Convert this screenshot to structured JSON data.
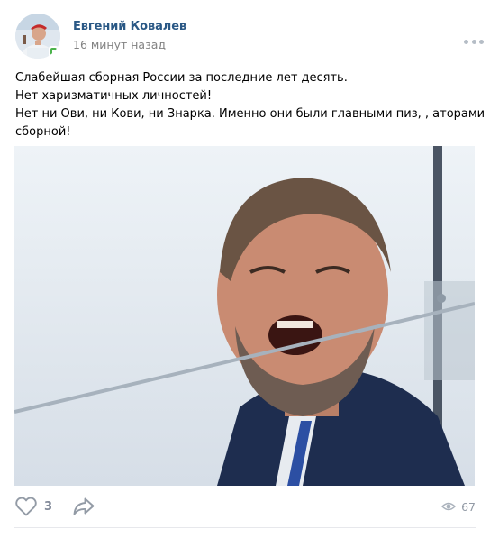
{
  "post": {
    "author": "Евгений Ковалев",
    "time": "16 минут назад",
    "text_lines": [
      "Слабейшая сборная России за последние лет десять.",
      "Нет харизматичных личностей!",
      "Нет ни Ови, ни Кови, ни Знарка. Именно они были главными пиз, , аторами",
      "сборной!"
    ]
  },
  "actions": {
    "like_count": "3",
    "view_count": "67"
  },
  "icons": {
    "more": "more-dots-icon",
    "like": "heart-icon",
    "share": "share-arrow-icon",
    "views": "eye-icon",
    "online": "mobile-online-icon"
  },
  "colors": {
    "author": "#2a5885",
    "meta": "#828282",
    "icon": "#939ba6",
    "online": "#4bb34b"
  }
}
